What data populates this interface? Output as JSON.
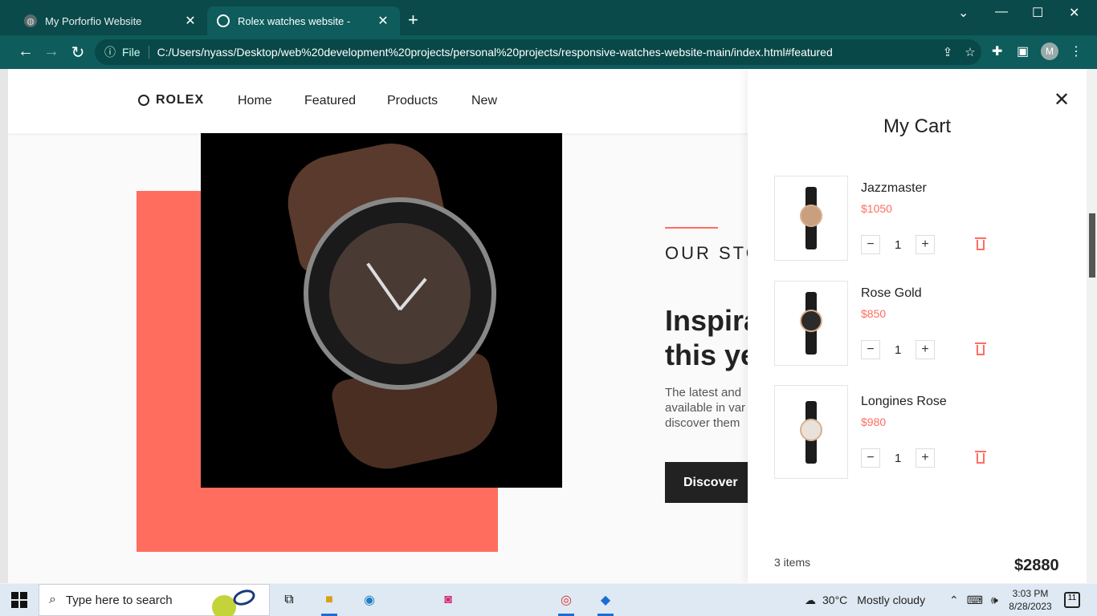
{
  "browser": {
    "tabs": [
      {
        "title": "My Porforfio Website",
        "active": false
      },
      {
        "title": "Rolex watches website -",
        "active": true
      }
    ],
    "address": {
      "scheme_label": "File",
      "url": "C:/Users/nyass/Desktop/web%20development%20projects/personal%20projects/responsive-watches-website-main/index.html#featured"
    },
    "profile_initial": "M"
  },
  "page": {
    "logo": "ROLEX",
    "nav": [
      "Home",
      "Featured",
      "Products",
      "New"
    ],
    "story": {
      "subtitle": "OUR STO",
      "title_line1": "Inspira",
      "title_line2": "this ye",
      "text_line1": "The latest and",
      "text_line2": "available in var",
      "text_line3": "discover them",
      "button": "Discover"
    },
    "colors": {
      "accent": "#ff6d5f",
      "dark": "#222222"
    }
  },
  "cart": {
    "title": "My Cart",
    "items": [
      {
        "name": "Jazzmaster",
        "price": "$1050",
        "qty": "1"
      },
      {
        "name": "Rose Gold",
        "price": "$850",
        "qty": "1"
      },
      {
        "name": "Longines Rose",
        "price": "$980",
        "qty": "1"
      }
    ],
    "count_label": "3 items",
    "total": "$2880"
  },
  "taskbar": {
    "search_placeholder": "Type here to search",
    "weather_temp": "30°C",
    "weather_desc": "Mostly cloudy",
    "time": "3:03 PM",
    "date": "8/28/2023",
    "notif_count": "11"
  }
}
